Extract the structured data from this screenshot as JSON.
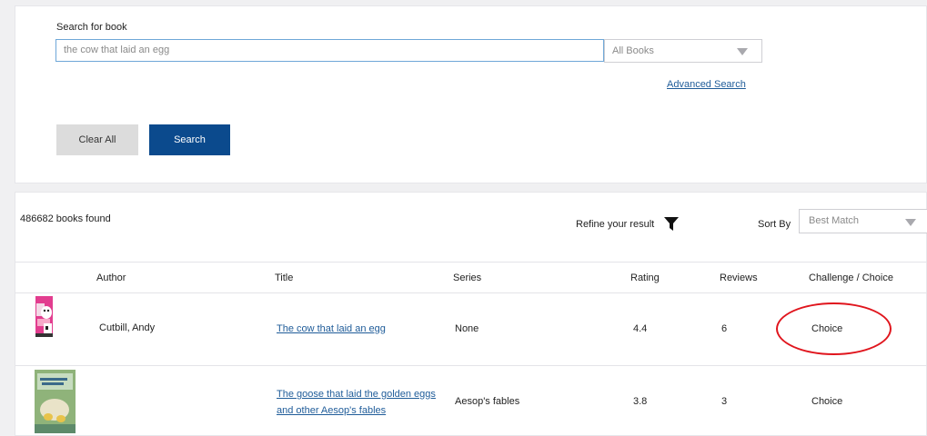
{
  "search": {
    "label": "Search for book",
    "query": "the cow that laid an egg",
    "scope_selected": "All Books",
    "advanced_label": "Advanced Search",
    "clear_label": "Clear All",
    "search_label": "Search"
  },
  "results": {
    "count_text": "486682 books found",
    "refine_label": "Refine your result",
    "sort_label": "Sort By",
    "sort_selected": "Best Match",
    "columns": {
      "author": "Author",
      "title": "Title",
      "series": "Series",
      "rating": "Rating",
      "reviews": "Reviews",
      "challenge": "Challenge / Choice"
    },
    "rows": [
      {
        "author": "Cutbill, Andy",
        "title": "The cow that laid an egg",
        "series": "None",
        "rating": "4.4",
        "reviews": "6",
        "challenge": "Choice"
      },
      {
        "author": "",
        "title_line1": "The goose that laid the golden eggs",
        "title_line2": "and other Aesop's fables",
        "series": "Aesop's fables",
        "rating": "3.8",
        "reviews": "3",
        "challenge": "Choice"
      }
    ]
  },
  "icons": {
    "caret": "chevron-down-icon",
    "filter": "funnel-icon"
  },
  "colors": {
    "primary_button": "#0b4a8d",
    "link": "#1f5c99",
    "annotation": "#e0151d"
  }
}
